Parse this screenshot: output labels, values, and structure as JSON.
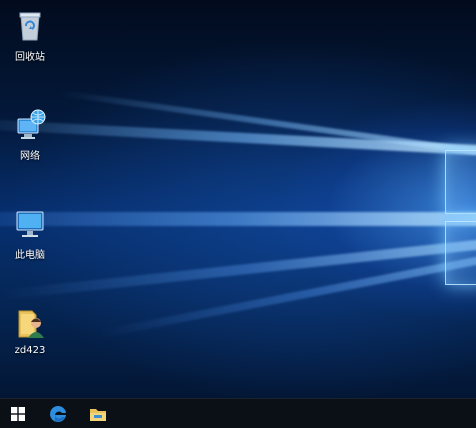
{
  "desktop": {
    "icons": [
      {
        "label": "回收站",
        "icon": "recycle-bin-icon"
      },
      {
        "label": "网络",
        "icon": "network-icon"
      },
      {
        "label": "此电脑",
        "icon": "this-pc-icon"
      },
      {
        "label": "zd423",
        "icon": "user-folder-icon"
      }
    ]
  },
  "taskbar": {
    "buttons": [
      {
        "icon": "windows-start-icon"
      },
      {
        "icon": "edge-browser-icon"
      },
      {
        "icon": "file-explorer-icon"
      }
    ]
  },
  "colors": {
    "wallpaper_blue": "#073071",
    "taskbar": "#0b0f16",
    "icon_text": "#ffffff"
  }
}
